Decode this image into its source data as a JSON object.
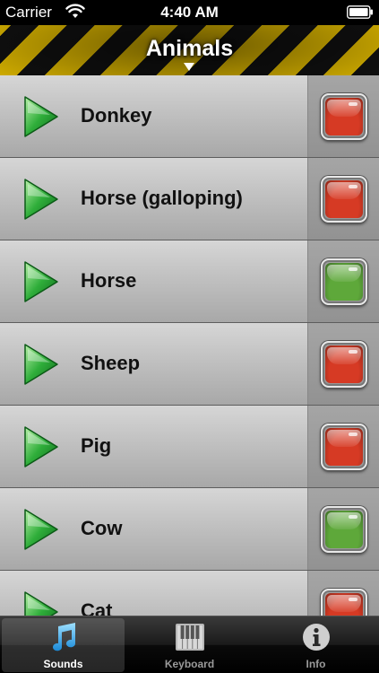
{
  "status_bar": {
    "carrier": "Carrier",
    "time": "4:40 AM",
    "wifi_icon": "wifi-icon",
    "battery_icon": "battery-icon"
  },
  "header": {
    "title": "Animals",
    "caret_icon": "caret-down-icon"
  },
  "colors": {
    "stripe_dark": "#111111",
    "stripe_yellow": "#e8c000",
    "toggle_red": "#d63a24",
    "toggle_green": "#5ea83a",
    "play_green": "#2fae3a",
    "tab_selected_blue": "#3ab0f0"
  },
  "sounds": [
    {
      "label": "Donkey",
      "state": "red"
    },
    {
      "label": "Horse (galloping)",
      "state": "red"
    },
    {
      "label": "Horse",
      "state": "green"
    },
    {
      "label": "Sheep",
      "state": "red"
    },
    {
      "label": "Pig",
      "state": "red"
    },
    {
      "label": "Cow",
      "state": "green"
    },
    {
      "label": "Cat",
      "state": "red"
    }
  ],
  "tabs": [
    {
      "label": "Sounds",
      "icon": "music-note-icon",
      "selected": true
    },
    {
      "label": "Keyboard",
      "icon": "piano-keyboard-icon",
      "selected": false
    },
    {
      "label": "Info",
      "icon": "info-icon",
      "selected": false
    }
  ]
}
